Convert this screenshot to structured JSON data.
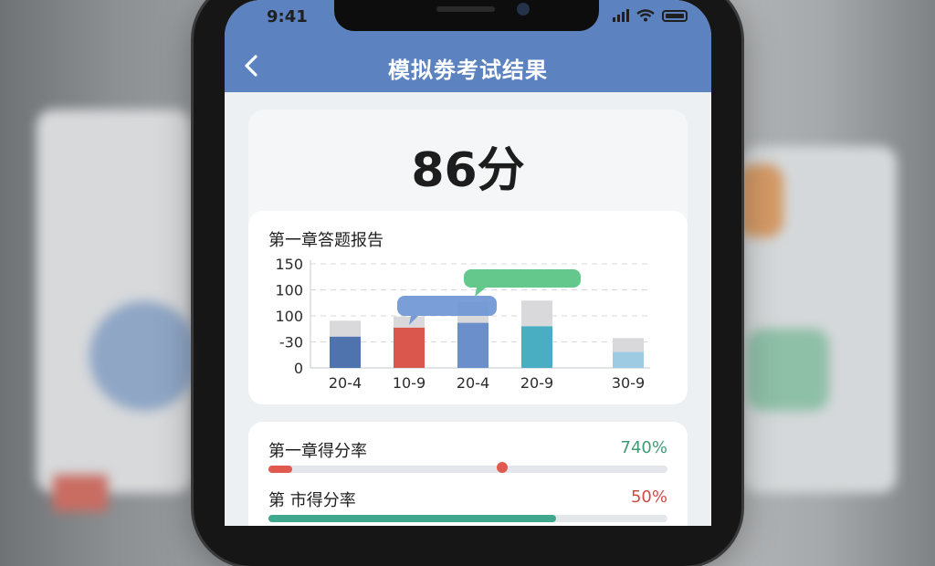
{
  "status_bar": {
    "time": "9:41"
  },
  "header": {
    "title": "模拟劵考试结果",
    "back_icon": "chevron-left-icon"
  },
  "score": {
    "text": "86分"
  },
  "chart_data": {
    "type": "bar",
    "title": "第一章答题报告",
    "y_tick_labels": [
      "150",
      "100",
      "100",
      "-30",
      "0"
    ],
    "categories": [
      "20-4",
      "10-9",
      "20-4",
      "20-9",
      "30-9"
    ],
    "ylim": [
      0,
      150
    ],
    "grid": true,
    "series": [
      {
        "values": [
          45,
          58,
          65,
          60,
          23
        ],
        "colors": [
          "#4f73ad",
          "#d9574c",
          "#6b8fcb",
          "#4aaec3",
          "#9ccbe3"
        ]
      },
      {
        "values": [
          23,
          16,
          30,
          37,
          20
        ],
        "color": "#d9d9dc"
      }
    ],
    "annotations": [
      {
        "color": "#6f96d4",
        "category_index": 1
      },
      {
        "color": "#5cc486",
        "category_index": 2
      }
    ]
  },
  "rates": [
    {
      "label": "第一章得分率",
      "value": "740%",
      "value_color": "#3f9b75",
      "fill_fraction": 0.06,
      "fill_color": "#e0594f",
      "knob_fraction": 0.585,
      "knob_color": "#e0594f"
    },
    {
      "label": "第 市得分率",
      "value": "50%",
      "value_color": "#d04a46",
      "fill_fraction": 0.72,
      "fill_color": "#3fa88e"
    }
  ],
  "colors": {
    "header": "#5c82bf",
    "background": "#edf0f3"
  }
}
